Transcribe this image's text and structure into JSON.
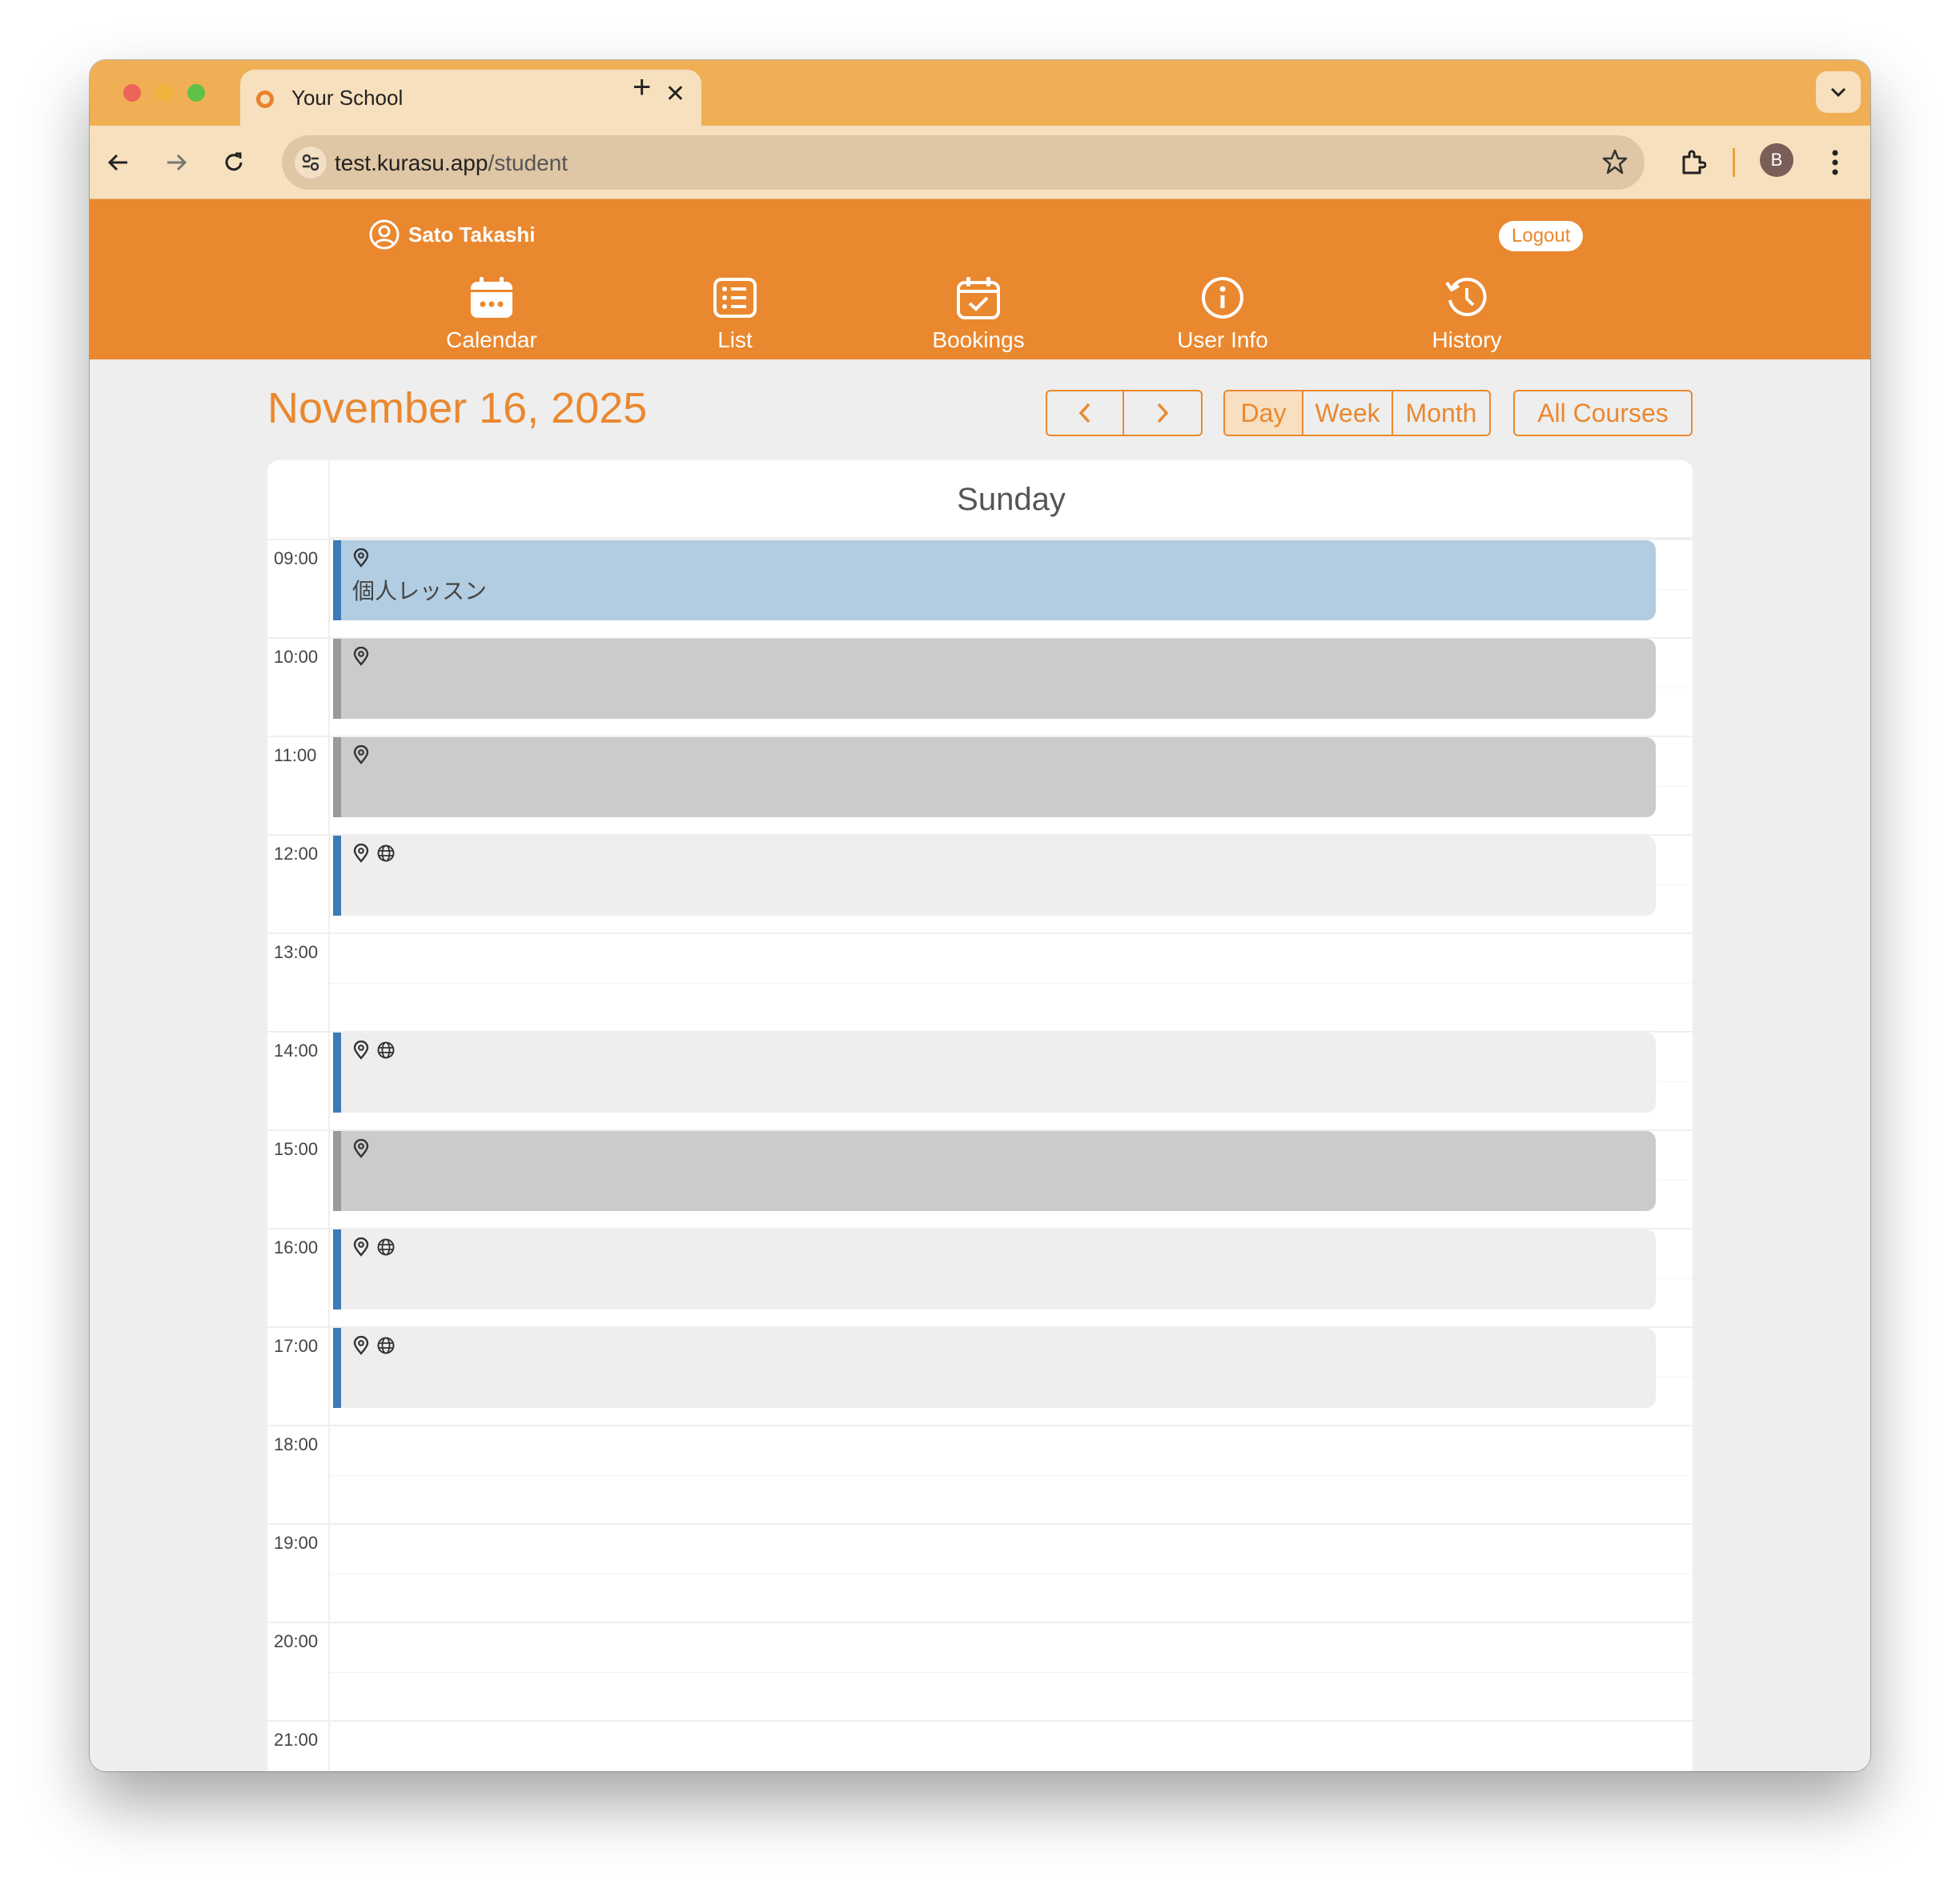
{
  "browser": {
    "tab_title": "Your School",
    "url_host": "test.kurasu.app",
    "url_path": "/student",
    "profile_initial": "B"
  },
  "header": {
    "user_name": "Sato Takashi",
    "logout_label": "Logout",
    "nav": [
      {
        "label": "Calendar",
        "icon": "calendar-icon"
      },
      {
        "label": "List",
        "icon": "list-icon"
      },
      {
        "label": "Bookings",
        "icon": "calendar-check-icon"
      },
      {
        "label": "User Info",
        "icon": "info-icon"
      },
      {
        "label": "History",
        "icon": "history-icon"
      }
    ]
  },
  "calendar": {
    "date_title": "November 16, 2025",
    "view_buttons": [
      "Day",
      "Week",
      "Month"
    ],
    "active_view": "Day",
    "filter_label": "All Courses",
    "day_name": "Sunday",
    "hours": [
      "09:00",
      "10:00",
      "11:00",
      "12:00",
      "13:00",
      "14:00",
      "15:00",
      "16:00",
      "17:00",
      "18:00",
      "19:00",
      "20:00",
      "21:00"
    ],
    "events": [
      {
        "hour": "09:00",
        "style": "blue",
        "title": "個人レッスン",
        "online": false
      },
      {
        "hour": "10:00",
        "style": "gray",
        "title": "",
        "online": false
      },
      {
        "hour": "11:00",
        "style": "gray",
        "title": "",
        "online": false
      },
      {
        "hour": "12:00",
        "style": "light",
        "title": "",
        "online": true
      },
      {
        "hour": "14:00",
        "style": "light",
        "title": "",
        "online": true
      },
      {
        "hour": "15:00",
        "style": "gray",
        "title": "",
        "online": false
      },
      {
        "hour": "16:00",
        "style": "light",
        "title": "",
        "online": true
      },
      {
        "hour": "17:00",
        "style": "light",
        "title": "",
        "online": true
      }
    ]
  },
  "colors": {
    "brand_orange": "#ea882f",
    "event_blue": "#3e7ab8",
    "tab_strip": "#f0ae55"
  }
}
